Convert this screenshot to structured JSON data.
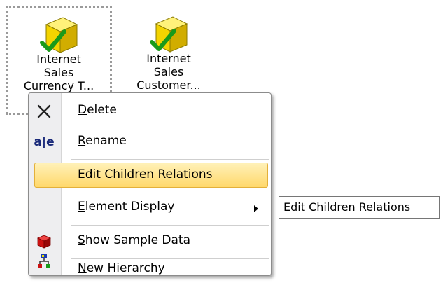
{
  "desktop": {
    "items": [
      {
        "label": "Internet Sales Currency T...",
        "icon": "cube-check-icon",
        "selected": true
      },
      {
        "label": "Internet Sales Customer...",
        "icon": "cube-check-icon",
        "selected": false
      }
    ]
  },
  "context_menu": {
    "items": [
      {
        "pre": "",
        "u": "D",
        "post": "elete",
        "icon": "delete-x-icon"
      },
      {
        "pre": "",
        "u": "R",
        "post": "ename",
        "icon": "rename-icon",
        "icon_text": "a|e"
      },
      {
        "pre": "Edit ",
        "u": "C",
        "post": "hildren Relations",
        "icon": "",
        "highlighted": true
      },
      {
        "pre": "",
        "u": "E",
        "post": "lement Display",
        "icon": "",
        "submenu": true
      },
      {
        "pre": "",
        "u": "S",
        "post": "how Sample Data",
        "icon": "red-cube-icon"
      },
      {
        "pre": "",
        "u": "N",
        "post": "ew Hierarchy",
        "icon": "hierarchy-icon"
      }
    ]
  },
  "tooltip": {
    "text": "Edit Children Relations"
  },
  "colors": {
    "highlight_top": "#fff1b8",
    "highlight_bottom": "#ffd86b",
    "highlight_border": "#e3b03a",
    "cube_yellow": "#f4d400",
    "check_green": "#1a9a1a",
    "red_cube": "#cc1111"
  }
}
